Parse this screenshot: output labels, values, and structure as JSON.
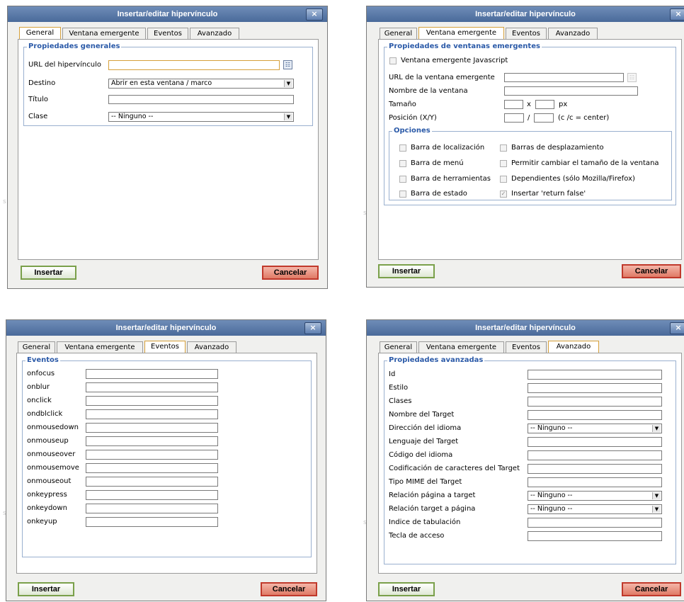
{
  "dialog_title": "Insertar/editar hipervínculo",
  "close_glyph": "×",
  "tabs": [
    "General",
    "Ventana emergente",
    "Eventos",
    "Avanzado"
  ],
  "buttons": {
    "insert": "Insertar",
    "cancel": "Cancelar"
  },
  "general": {
    "legend": "Propiedades generales",
    "url_label": "URL del hipervínculo",
    "url_value": "",
    "target_label": "Destino",
    "target_value": "Abrir en esta ventana / marco",
    "title_label": "Título",
    "title_value": "",
    "class_label": "Clase",
    "class_value": "-- Ninguno --"
  },
  "popup": {
    "legend": "Propiedades de ventanas emergentes",
    "js_popup_label": "Ventana emergente Javascript",
    "popup_url_label": "URL de la ventana emergente",
    "window_name_label": "Nombre de la ventana",
    "size_label": "Tamaño",
    "size_sep": "x",
    "size_unit": "px",
    "position_label": "Posición (X/Y)",
    "position_sep": "/",
    "position_hint": "(c /c = center)",
    "options_legend": "Opciones",
    "options": [
      {
        "label": "Barra de localización",
        "checked": false
      },
      {
        "label": "Barras de desplazamiento",
        "checked": false
      },
      {
        "label": "Barra de menú",
        "checked": false
      },
      {
        "label": "Permitir cambiar el tamaño de la ventana",
        "checked": false
      },
      {
        "label": "Barra de herramientas",
        "checked": false
      },
      {
        "label": "Dependientes (sólo Mozilla/Firefox)",
        "checked": false
      },
      {
        "label": "Barra de estado",
        "checked": false
      },
      {
        "label": "Insertar 'return false'",
        "checked": true
      }
    ]
  },
  "events": {
    "legend": "Eventos",
    "items": [
      "onfocus",
      "onblur",
      "onclick",
      "ondblclick",
      "onmousedown",
      "onmouseup",
      "onmouseover",
      "onmousemove",
      "onmouseout",
      "onkeypress",
      "onkeydown",
      "onkeyup"
    ]
  },
  "advanced": {
    "legend": "Propiedades avanzadas",
    "fields": [
      {
        "label": "Id",
        "type": "input"
      },
      {
        "label": "Estilo",
        "type": "input"
      },
      {
        "label": "Clases",
        "type": "input"
      },
      {
        "label": "Nombre del Target",
        "type": "input"
      },
      {
        "label": "Dirección del idioma",
        "type": "select",
        "value": "-- Ninguno --"
      },
      {
        "label": "Lenguaje del Target",
        "type": "input"
      },
      {
        "label": "Código del idioma",
        "type": "input"
      },
      {
        "label": "Codificación de caracteres del Target",
        "type": "input"
      },
      {
        "label": "Tipo MIME del Target",
        "type": "input"
      },
      {
        "label": "Relación página a target",
        "type": "select",
        "value": "-- Ninguno --"
      },
      {
        "label": "Relación target a página",
        "type": "select",
        "value": "-- Ninguno --"
      },
      {
        "label": "Indice de tabulación",
        "type": "input"
      },
      {
        "label": "Tecla de acceso",
        "type": "input"
      }
    ]
  }
}
